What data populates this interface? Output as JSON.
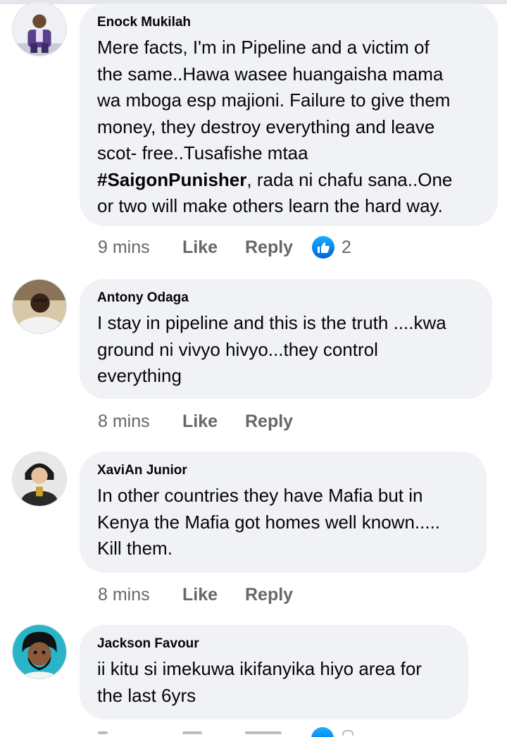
{
  "comments": [
    {
      "author": "Enock Mukilah",
      "text_before_hashtag": "Mere facts, I'm in Pipeline and a victim of\nthe same..Hawa wasee huangaisha mama\nwa mboga esp majioni. Failure to give them\nmoney, they destroy everything and leave\nscot- free..Tusafishe mtaa\n",
      "hashtag": "#SaigonPunisher",
      "text_after_hashtag": ", rada ni chafu sana..One\nor two will make others learn the hard way.",
      "time": "9 mins",
      "like_label": "Like",
      "reply_label": "Reply",
      "reaction_icon": "like-reaction-icon",
      "reaction_count": "2"
    },
    {
      "author": "Antony Odaga",
      "text": "I stay in pipeline and this is the truth ....kwa\nground ni vivyo hivyo...they control\neverything",
      "time": "8 mins",
      "like_label": "Like",
      "reply_label": "Reply"
    },
    {
      "author": "XaviAn Junior",
      "text": "In other countries they have Mafia but in\nKenya the Mafia got homes well known.....\nKill them.",
      "time": "8 mins",
      "like_label": "Like",
      "reply_label": "Reply"
    },
    {
      "author": "Jackson Favour",
      "text": "ii kitu si imekuwa ikifanyika hiyo area for\nthe last 6yrs",
      "reaction_icon": "like-reaction-icon"
    }
  ],
  "colors": {
    "bubble_bg": "#f0f2f5",
    "meta_text": "#65676b",
    "like_blue": "#1877f2"
  }
}
